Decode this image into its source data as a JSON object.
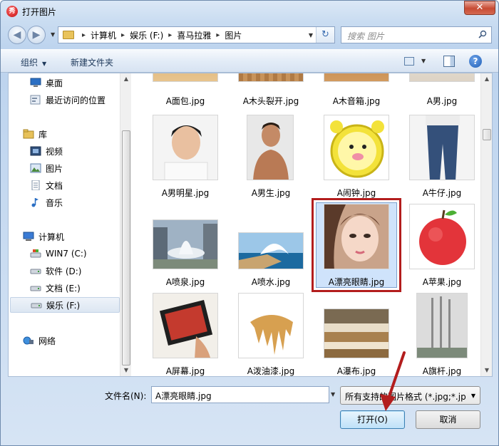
{
  "window": {
    "title": "打开图片",
    "close_label": "✕"
  },
  "address": {
    "crumbs": [
      "计算机",
      "娱乐 (F:)",
      "喜马拉雅",
      "图片"
    ],
    "refresh_label": "↻"
  },
  "search": {
    "placeholder": "搜索 图片"
  },
  "toolbar": {
    "organize_label": "组织",
    "new_folder_label": "新建文件夹"
  },
  "nav": {
    "items": [
      {
        "label": "桌面",
        "icon": "desktop-icon"
      },
      {
        "label": "最近访问的位置",
        "icon": "recent-places-icon"
      },
      {
        "label": "库",
        "icon": "library-icon"
      },
      {
        "label": "视频",
        "icon": "videos-icon"
      },
      {
        "label": "图片",
        "icon": "pictures-icon"
      },
      {
        "label": "文档",
        "icon": "documents-icon"
      },
      {
        "label": "音乐",
        "icon": "music-icon"
      },
      {
        "label": "计算机",
        "icon": "computer-icon"
      },
      {
        "label": "WIN7 (C:)",
        "icon": "drive-windows-icon"
      },
      {
        "label": "软件 (D:)",
        "icon": "drive-icon"
      },
      {
        "label": "文档 (E:)",
        "icon": "drive-icon"
      },
      {
        "label": "娱乐 (F:)",
        "icon": "drive-icon"
      },
      {
        "label": "网络",
        "icon": "network-icon"
      }
    ],
    "selected": "娱乐 (F:)"
  },
  "files": {
    "partial_row": [
      "A面包.jpg",
      "A木头裂开.jpg",
      "A木音箱.jpg",
      "A男.jpg"
    ],
    "rows": [
      [
        "A男明星.jpg",
        "A男生.jpg",
        "A闹钟.jpg",
        "A牛仔.jpg"
      ],
      [
        "A喷泉.jpg",
        "A喷水.jpg",
        "A漂亮眼睛.jpg",
        "A苹果.jpg"
      ],
      [
        "A屏幕.jpg",
        "A泼油漆.jpg",
        "A瀑布.jpg",
        "A旗杆.jpg"
      ]
    ],
    "selected": "A漂亮眼睛.jpg"
  },
  "bottom": {
    "filename_label": "文件名(N):",
    "filename_value": "A漂亮眼睛.jpg",
    "filetype_value": "所有支持的图片格式 (*.jpg;*.jp",
    "open_label": "打开(O)",
    "cancel_label": "取消"
  },
  "colors": {
    "selection_border": "#b31d1d",
    "annotation_arrow": "#b31d1d"
  }
}
